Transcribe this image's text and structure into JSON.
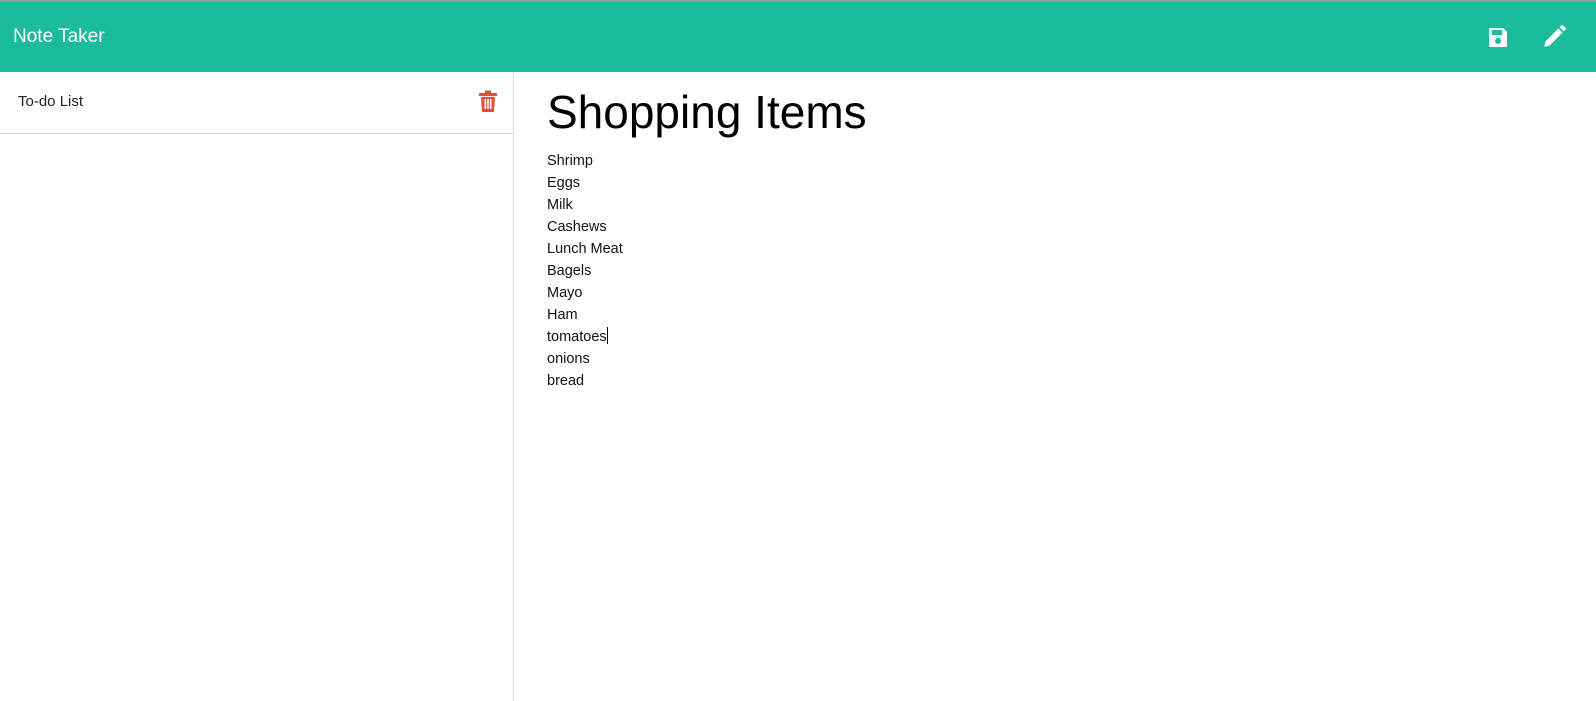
{
  "header": {
    "title": "Note Taker",
    "save_icon": "floppy-disk-icon",
    "edit_icon": "pencil-icon",
    "color": "#1abc9c"
  },
  "sidebar": {
    "notes": [
      {
        "title": "To-do List",
        "delete_icon": "trash-icon",
        "delete_color": "#e74c3c"
      }
    ]
  },
  "note": {
    "title": "Shopping Items",
    "lines": [
      "Shrimp",
      "Eggs",
      "Milk",
      "Cashews",
      "Lunch Meat",
      "Bagels",
      "Mayo",
      "Ham",
      "tomatoes",
      "onions",
      "bread"
    ]
  }
}
